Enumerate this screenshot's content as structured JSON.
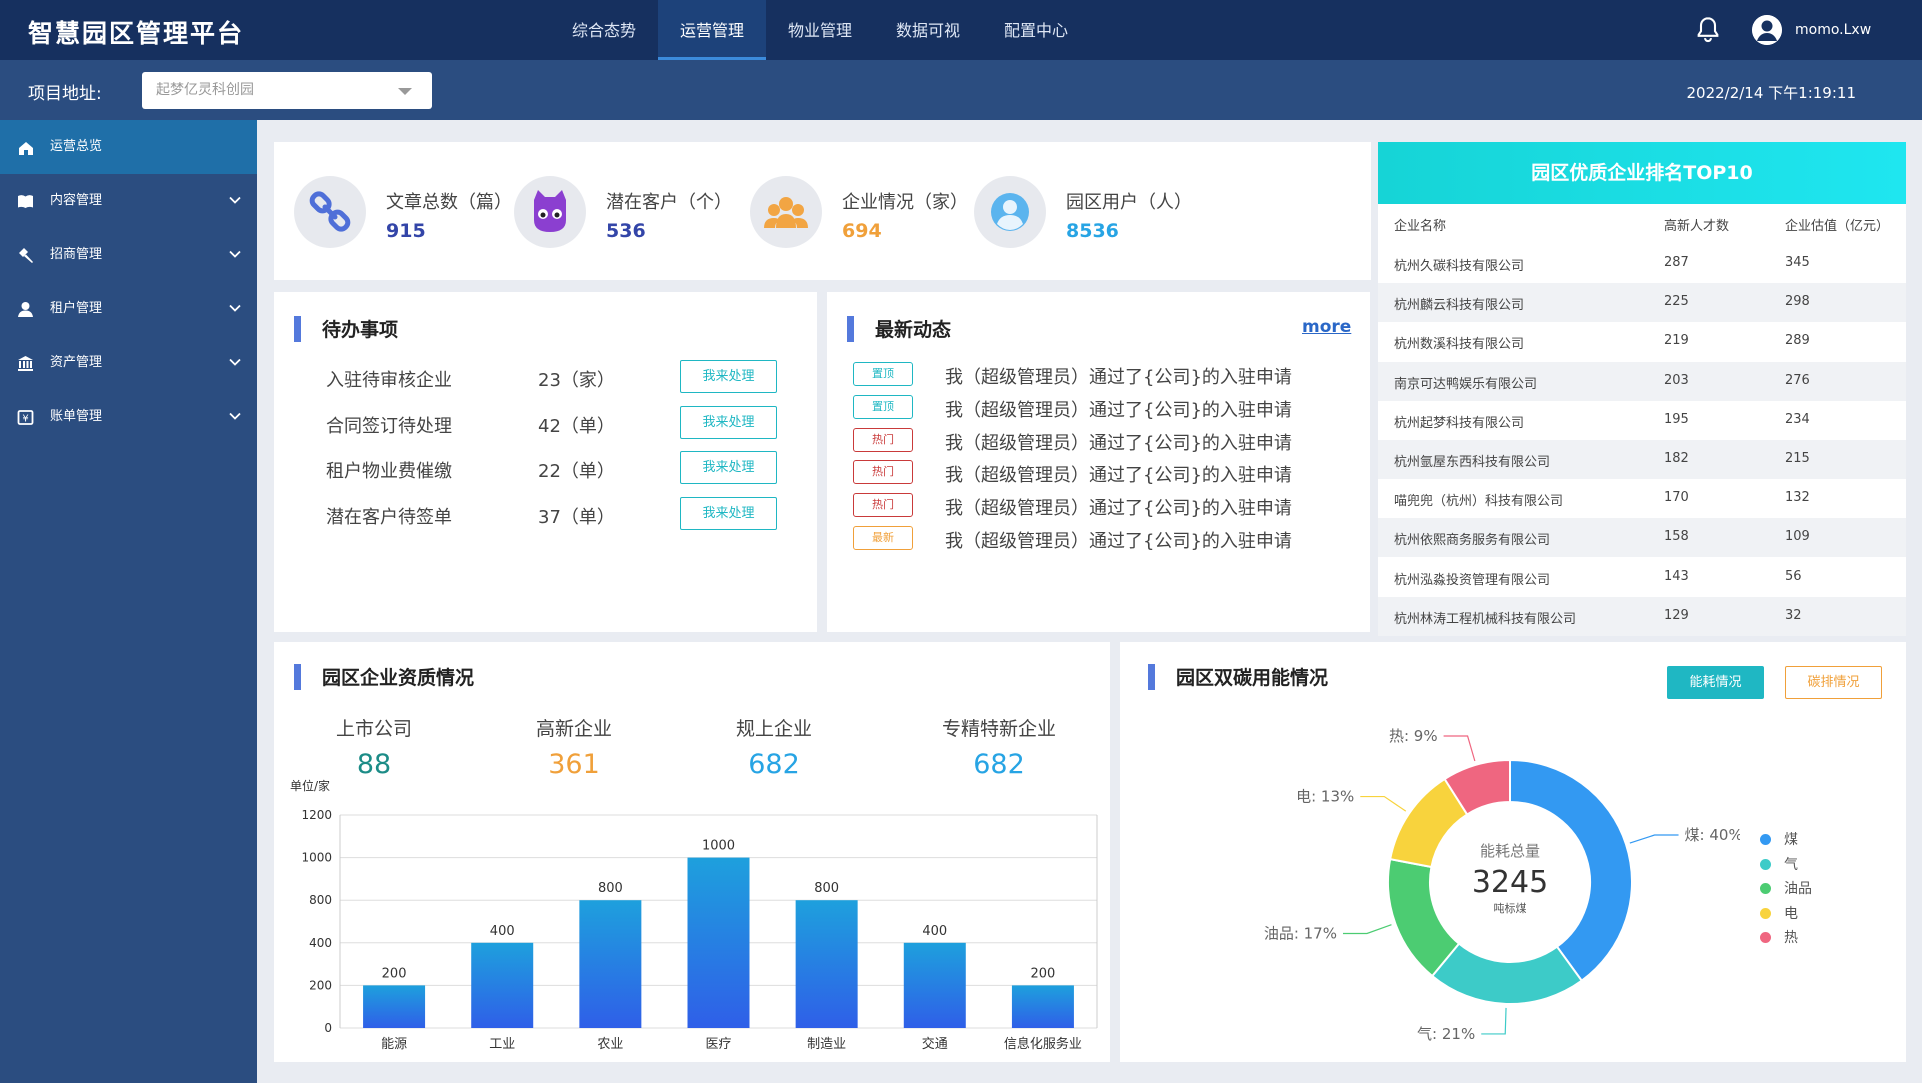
{
  "app": {
    "title": "智慧园区管理平台"
  },
  "nav": {
    "items": [
      "综合态势",
      "运营管理",
      "物业管理",
      "数据可视",
      "配置中心"
    ],
    "active": 1
  },
  "user": {
    "name": "momo.Lxw"
  },
  "project": {
    "label": "项目地址:",
    "value": "起梦亿灵科创园",
    "datetime": "2022/2/14 下午1:19:11"
  },
  "sidebar": {
    "items": [
      {
        "label": "运营总览",
        "icon": "home-icon"
      },
      {
        "label": "内容管理",
        "icon": "book-icon"
      },
      {
        "label": "招商管理",
        "icon": "hammer-icon"
      },
      {
        "label": "租户管理",
        "icon": "user-icon"
      },
      {
        "label": "资产管理",
        "icon": "bank-icon"
      },
      {
        "label": "账单管理",
        "icon": "bill-icon"
      }
    ]
  },
  "stats": [
    {
      "label": "文章总数（篇）",
      "value": "915",
      "color": "#3345a8",
      "icon": "link-icon"
    },
    {
      "label": "潜在客户（个）",
      "value": "536",
      "color": "#3345a8",
      "icon": "cat-icon"
    },
    {
      "label": "企业情况（家）",
      "value": "694",
      "color": "#f0a03a",
      "icon": "group-icon"
    },
    {
      "label": "园区用户（人）",
      "value": "8536",
      "color": "#27a4e4",
      "icon": "person-icon"
    }
  ],
  "todo": {
    "title": "待办事项",
    "items": [
      {
        "name": "入驻待审核企业",
        "count": "23（家）",
        "action": "我来处理"
      },
      {
        "name": "合同签订待处理",
        "count": "42（单）",
        "action": "我来处理"
      },
      {
        "name": "租户物业费催缴",
        "count": "22（单）",
        "action": "我来处理"
      },
      {
        "name": "潜在客户待签单",
        "count": "37（单）",
        "action": "我来处理"
      }
    ]
  },
  "news": {
    "title": "最新动态",
    "more": "more",
    "items": [
      {
        "tag": "置顶",
        "tag_color": "#1fb7c3",
        "text": "我（超级管理员）通过了{公司}的入驻申请"
      },
      {
        "tag": "置顶",
        "tag_color": "#1fb7c3",
        "text": "我（超级管理员）通过了{公司}的入驻申请"
      },
      {
        "tag": "热门",
        "tag_color": "#c93a3a",
        "text": "我（超级管理员）通过了{公司}的入驻申请"
      },
      {
        "tag": "热门",
        "tag_color": "#c93a3a",
        "text": "我（超级管理员）通过了{公司}的入驻申请"
      },
      {
        "tag": "热门",
        "tag_color": "#c93a3a",
        "text": "我（超级管理员）通过了{公司}的入驻申请"
      },
      {
        "tag": "最新",
        "tag_color": "#f0a03a",
        "text": "我（超级管理员）通过了{公司}的入驻申请"
      }
    ]
  },
  "ranking": {
    "title": "园区优质企业排名TOP10",
    "columns": [
      "企业名称",
      "高新人才数",
      "企业估值（亿元）"
    ],
    "rows": [
      [
        "杭州久碳科技有限公司",
        "287",
        "345"
      ],
      [
        "杭州麟云科技有限公司",
        "225",
        "298"
      ],
      [
        "杭州数溪科技有限公司",
        "219",
        "289"
      ],
      [
        "南京可达鸭娱乐有限公司",
        "203",
        "276"
      ],
      [
        "杭州起梦科技有限公司",
        "195",
        "234"
      ],
      [
        "杭州氩屋东西科技有限公司",
        "182",
        "215"
      ],
      [
        "喵兜兜（杭州）科技有限公司",
        "170",
        "132"
      ],
      [
        "杭州依熙商务服务有限公司",
        "158",
        "109"
      ],
      [
        "杭州泓淼投资管理有限公司",
        "143",
        "56"
      ],
      [
        "杭州林涛工程机械科技有限公司",
        "129",
        "32"
      ]
    ]
  },
  "qualification": {
    "title": "园区企业资质情况",
    "items": [
      {
        "label": "上市公司",
        "value": "88",
        "color": "#1c8c87"
      },
      {
        "label": "高新企业",
        "value": "361",
        "color": "#f0a03a"
      },
      {
        "label": "规上企业",
        "value": "682",
        "color": "#27a4e4"
      },
      {
        "label": "专精特新企业",
        "value": "682",
        "color": "#27a4e4"
      }
    ]
  },
  "energy": {
    "title": "园区双碳用能情况",
    "buttons": [
      "能耗情况",
      "碳排情况"
    ],
    "center_label": "能耗总量",
    "center_value": "3245",
    "center_unit": "吨标煤"
  },
  "chart_data": [
    {
      "type": "bar",
      "unit_label": "单位/家",
      "categories": [
        "能源",
        "工业",
        "农业",
        "医疗",
        "制造业",
        "交通",
        "信息化服务业"
      ],
      "values": [
        200,
        400,
        800,
        1000,
        800,
        400,
        200
      ],
      "y_ticks": [
        0,
        200,
        400,
        800,
        1000,
        1200
      ],
      "grid": true,
      "colors": [
        "#1ea0dd",
        "#2f5fe8"
      ]
    },
    {
      "type": "pie",
      "donut": true,
      "slices": [
        {
          "name": "煤",
          "value": 40,
          "label": "煤: 40%",
          "color": "#3399f2"
        },
        {
          "name": "气",
          "value": 21,
          "label": "气: 21%",
          "color": "#3dcbc8"
        },
        {
          "name": "油品",
          "value": 17,
          "label": "油品: 17%",
          "color": "#4ccc72"
        },
        {
          "name": "电",
          "value": 13,
          "label": "电: 13%",
          "color": "#f8d33d"
        },
        {
          "name": "热",
          "value": 9,
          "label": "热: 9%",
          "color": "#ef6680"
        }
      ],
      "legend_position": "right"
    }
  ]
}
